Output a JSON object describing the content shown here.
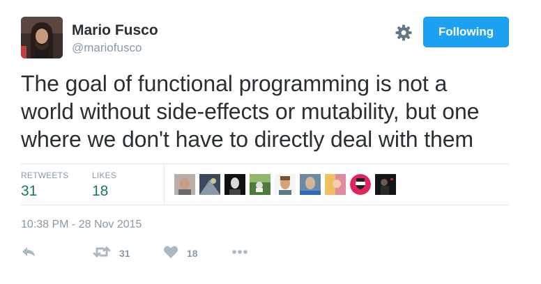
{
  "author": {
    "name": "Mario Fusco",
    "handle": "@mariofusco"
  },
  "follow_button": {
    "label": "Following",
    "color": "#1da1f2"
  },
  "tweet": {
    "lines": [
      "The goal of functional programming is not a",
      "world without side-effects or mutability, but one",
      "where we don't have to directly deal with them"
    ]
  },
  "stats": {
    "retweets": {
      "label": "RETWEETS",
      "count": "31"
    },
    "likes": {
      "label": "LIKES",
      "count": "18"
    }
  },
  "liker_faces": [
    "face-1",
    "face-2",
    "face-3",
    "face-4",
    "face-5",
    "face-6",
    "face-7",
    "face-8",
    "face-9"
  ],
  "timestamp": "10:38 PM - 28 Nov 2015",
  "actions": {
    "reply": {
      "icon": "reply-icon"
    },
    "retweet": {
      "icon": "retweet-icon",
      "count": "31"
    },
    "like": {
      "icon": "heart-icon",
      "count": "18"
    },
    "more": {
      "icon": "more-icon"
    }
  },
  "colors": {
    "text": "#292f33",
    "muted": "#8899a6",
    "count": "#0f7f4a",
    "border": "#e1e8ed"
  }
}
